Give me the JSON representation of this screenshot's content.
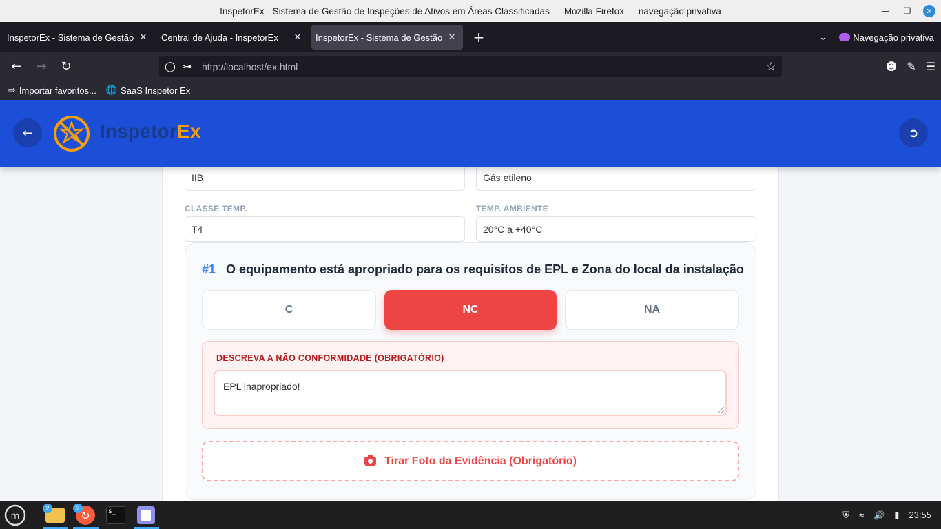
{
  "window": {
    "title": "InspetorEx - Sistema de Gestão de Inspeções de Ativos em Áreas Classificadas — Mozilla Firefox — navegação privativa"
  },
  "tabs": [
    {
      "label": "InspetorEx - Sistema de Gestão de Inspeções"
    },
    {
      "label": "Central de Ajuda - InspetorEx"
    },
    {
      "label": "InspetorEx - Sistema de Gestão de Inspeções"
    }
  ],
  "private_label": "Navegação privativa",
  "urlbar": {
    "url": "http://localhost/ex.html"
  },
  "bookmarks": [
    {
      "label": "Importar favoritos..."
    },
    {
      "label": "SaaS Inspetor Ex"
    }
  ],
  "app": {
    "brand_part1": "Inspetor",
    "brand_part2": "Ex",
    "colors": {
      "header": "#1d4ed8",
      "accent": "#f59e0b",
      "danger": "#ef4444",
      "question_number": "#3b82f6"
    }
  },
  "fields": {
    "grupo_value": "IIB",
    "gas_value": "Gás etileno",
    "classe_temp_label": "CLASSE TEMP.",
    "classe_temp_value": "T4",
    "temp_ambiente_label": "TEMP. AMBIENTE",
    "temp_ambiente_value": "20°C a +40°C"
  },
  "question": {
    "number": "#1",
    "text": "O equipamento está apropriado para os requisitos de EPL e Zona do local da instalação",
    "options": [
      "C",
      "NC",
      "NA"
    ],
    "selected": "NC",
    "nc_label": "DESCREVA A NÃO CONFORMIDADE (OBRIGATÓRIO)",
    "nc_text": "EPL inapropriado!",
    "photo_button": "Tirar Foto da Evidência (Obrigatório)"
  },
  "taskbar": {
    "files_badge": "2",
    "firefox_badge": "2",
    "clock": "23:55"
  }
}
